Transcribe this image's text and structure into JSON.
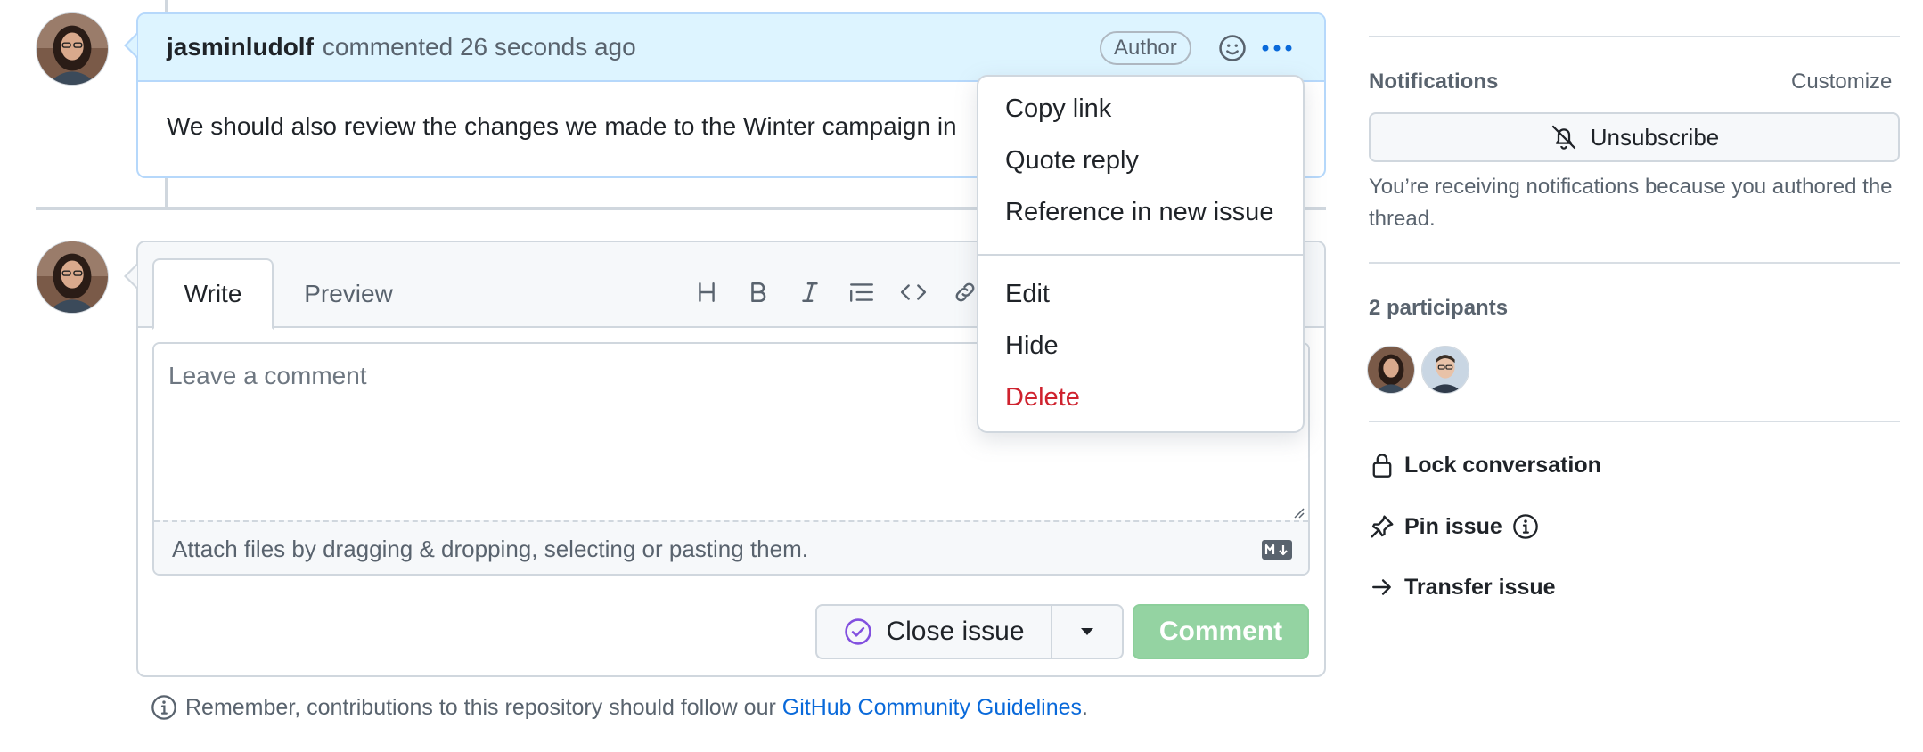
{
  "comment": {
    "author": "jasminludolf",
    "meta": "commented 26 seconds ago",
    "badge": "Author",
    "body": "We should also review the changes we made to the Winter campaign in"
  },
  "menu": {
    "items": [
      "Copy link",
      "Quote reply",
      "Reference in new issue"
    ],
    "items2": [
      "Edit",
      "Hide"
    ],
    "delete_label": "Delete",
    "delete_color": "#cf222e"
  },
  "composer": {
    "tabs": [
      "Write",
      "Preview"
    ],
    "toolbar_icons": [
      "heading-icon",
      "bold-icon",
      "italic-icon",
      "quote-icon",
      "code-icon",
      "link-icon"
    ],
    "placeholder": "Leave a comment",
    "attach_text": "Attach files by dragging & dropping, selecting or pasting them.",
    "close_issue_label": "Close issue",
    "comment_label": "Comment",
    "comment_color": "#94d3a2"
  },
  "guidelines": {
    "prefix": "Remember, contributions to this repository should follow our",
    "link": "GitHub Community Guidelines",
    "suffix": "."
  },
  "sidebar": {
    "notifications_heading": "Notifications",
    "customize": "Customize",
    "unsubscribe_label": "Unsubscribe",
    "notif_text": "You’re receiving notifications because you authored the thread.",
    "participants_heading": "2 participants",
    "actions": {
      "lock": "Lock conversation",
      "pin": "Pin issue",
      "transfer": "Transfer issue"
    }
  },
  "colors": {
    "accent_blue": "#0969da",
    "header_blue": "#ddf4ff",
    "border_blue": "#b6d8fb"
  }
}
